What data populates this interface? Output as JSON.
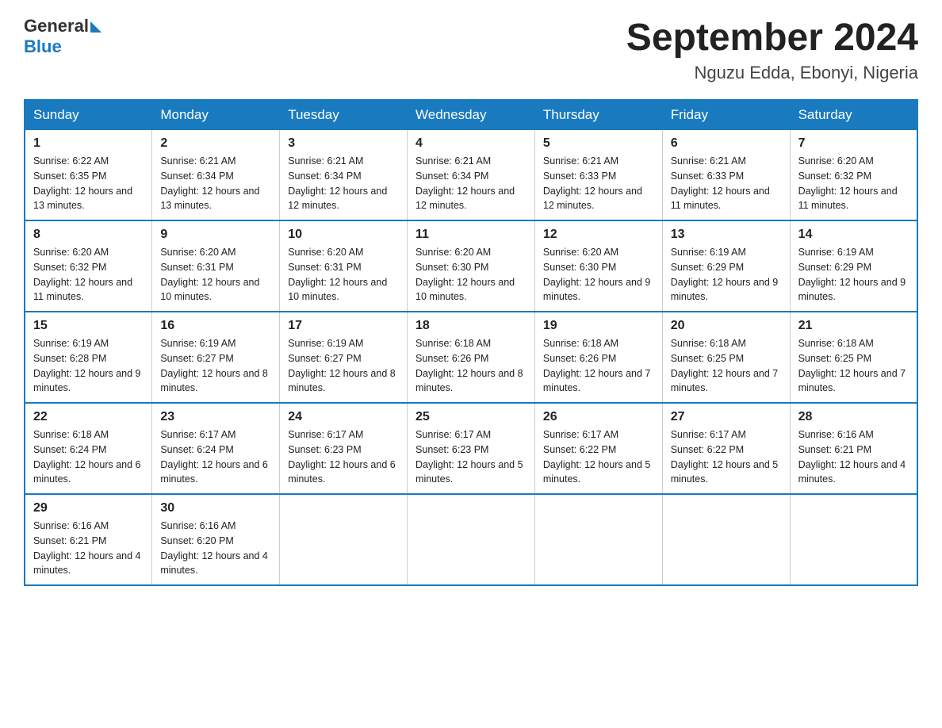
{
  "header": {
    "logo_text_general": "General",
    "logo_text_blue": "Blue",
    "title": "September 2024",
    "subtitle": "Nguzu Edda, Ebonyi, Nigeria"
  },
  "days_of_week": [
    "Sunday",
    "Monday",
    "Tuesday",
    "Wednesday",
    "Thursday",
    "Friday",
    "Saturday"
  ],
  "weeks": [
    [
      {
        "day": "1",
        "sunrise": "Sunrise: 6:22 AM",
        "sunset": "Sunset: 6:35 PM",
        "daylight": "Daylight: 12 hours and 13 minutes."
      },
      {
        "day": "2",
        "sunrise": "Sunrise: 6:21 AM",
        "sunset": "Sunset: 6:34 PM",
        "daylight": "Daylight: 12 hours and 13 minutes."
      },
      {
        "day": "3",
        "sunrise": "Sunrise: 6:21 AM",
        "sunset": "Sunset: 6:34 PM",
        "daylight": "Daylight: 12 hours and 12 minutes."
      },
      {
        "day": "4",
        "sunrise": "Sunrise: 6:21 AM",
        "sunset": "Sunset: 6:34 PM",
        "daylight": "Daylight: 12 hours and 12 minutes."
      },
      {
        "day": "5",
        "sunrise": "Sunrise: 6:21 AM",
        "sunset": "Sunset: 6:33 PM",
        "daylight": "Daylight: 12 hours and 12 minutes."
      },
      {
        "day": "6",
        "sunrise": "Sunrise: 6:21 AM",
        "sunset": "Sunset: 6:33 PM",
        "daylight": "Daylight: 12 hours and 11 minutes."
      },
      {
        "day": "7",
        "sunrise": "Sunrise: 6:20 AM",
        "sunset": "Sunset: 6:32 PM",
        "daylight": "Daylight: 12 hours and 11 minutes."
      }
    ],
    [
      {
        "day": "8",
        "sunrise": "Sunrise: 6:20 AM",
        "sunset": "Sunset: 6:32 PM",
        "daylight": "Daylight: 12 hours and 11 minutes."
      },
      {
        "day": "9",
        "sunrise": "Sunrise: 6:20 AM",
        "sunset": "Sunset: 6:31 PM",
        "daylight": "Daylight: 12 hours and 10 minutes."
      },
      {
        "day": "10",
        "sunrise": "Sunrise: 6:20 AM",
        "sunset": "Sunset: 6:31 PM",
        "daylight": "Daylight: 12 hours and 10 minutes."
      },
      {
        "day": "11",
        "sunrise": "Sunrise: 6:20 AM",
        "sunset": "Sunset: 6:30 PM",
        "daylight": "Daylight: 12 hours and 10 minutes."
      },
      {
        "day": "12",
        "sunrise": "Sunrise: 6:20 AM",
        "sunset": "Sunset: 6:30 PM",
        "daylight": "Daylight: 12 hours and 9 minutes."
      },
      {
        "day": "13",
        "sunrise": "Sunrise: 6:19 AM",
        "sunset": "Sunset: 6:29 PM",
        "daylight": "Daylight: 12 hours and 9 minutes."
      },
      {
        "day": "14",
        "sunrise": "Sunrise: 6:19 AM",
        "sunset": "Sunset: 6:29 PM",
        "daylight": "Daylight: 12 hours and 9 minutes."
      }
    ],
    [
      {
        "day": "15",
        "sunrise": "Sunrise: 6:19 AM",
        "sunset": "Sunset: 6:28 PM",
        "daylight": "Daylight: 12 hours and 9 minutes."
      },
      {
        "day": "16",
        "sunrise": "Sunrise: 6:19 AM",
        "sunset": "Sunset: 6:27 PM",
        "daylight": "Daylight: 12 hours and 8 minutes."
      },
      {
        "day": "17",
        "sunrise": "Sunrise: 6:19 AM",
        "sunset": "Sunset: 6:27 PM",
        "daylight": "Daylight: 12 hours and 8 minutes."
      },
      {
        "day": "18",
        "sunrise": "Sunrise: 6:18 AM",
        "sunset": "Sunset: 6:26 PM",
        "daylight": "Daylight: 12 hours and 8 minutes."
      },
      {
        "day": "19",
        "sunrise": "Sunrise: 6:18 AM",
        "sunset": "Sunset: 6:26 PM",
        "daylight": "Daylight: 12 hours and 7 minutes."
      },
      {
        "day": "20",
        "sunrise": "Sunrise: 6:18 AM",
        "sunset": "Sunset: 6:25 PM",
        "daylight": "Daylight: 12 hours and 7 minutes."
      },
      {
        "day": "21",
        "sunrise": "Sunrise: 6:18 AM",
        "sunset": "Sunset: 6:25 PM",
        "daylight": "Daylight: 12 hours and 7 minutes."
      }
    ],
    [
      {
        "day": "22",
        "sunrise": "Sunrise: 6:18 AM",
        "sunset": "Sunset: 6:24 PM",
        "daylight": "Daylight: 12 hours and 6 minutes."
      },
      {
        "day": "23",
        "sunrise": "Sunrise: 6:17 AM",
        "sunset": "Sunset: 6:24 PM",
        "daylight": "Daylight: 12 hours and 6 minutes."
      },
      {
        "day": "24",
        "sunrise": "Sunrise: 6:17 AM",
        "sunset": "Sunset: 6:23 PM",
        "daylight": "Daylight: 12 hours and 6 minutes."
      },
      {
        "day": "25",
        "sunrise": "Sunrise: 6:17 AM",
        "sunset": "Sunset: 6:23 PM",
        "daylight": "Daylight: 12 hours and 5 minutes."
      },
      {
        "day": "26",
        "sunrise": "Sunrise: 6:17 AM",
        "sunset": "Sunset: 6:22 PM",
        "daylight": "Daylight: 12 hours and 5 minutes."
      },
      {
        "day": "27",
        "sunrise": "Sunrise: 6:17 AM",
        "sunset": "Sunset: 6:22 PM",
        "daylight": "Daylight: 12 hours and 5 minutes."
      },
      {
        "day": "28",
        "sunrise": "Sunrise: 6:16 AM",
        "sunset": "Sunset: 6:21 PM",
        "daylight": "Daylight: 12 hours and 4 minutes."
      }
    ],
    [
      {
        "day": "29",
        "sunrise": "Sunrise: 6:16 AM",
        "sunset": "Sunset: 6:21 PM",
        "daylight": "Daylight: 12 hours and 4 minutes."
      },
      {
        "day": "30",
        "sunrise": "Sunrise: 6:16 AM",
        "sunset": "Sunset: 6:20 PM",
        "daylight": "Daylight: 12 hours and 4 minutes."
      },
      null,
      null,
      null,
      null,
      null
    ]
  ]
}
